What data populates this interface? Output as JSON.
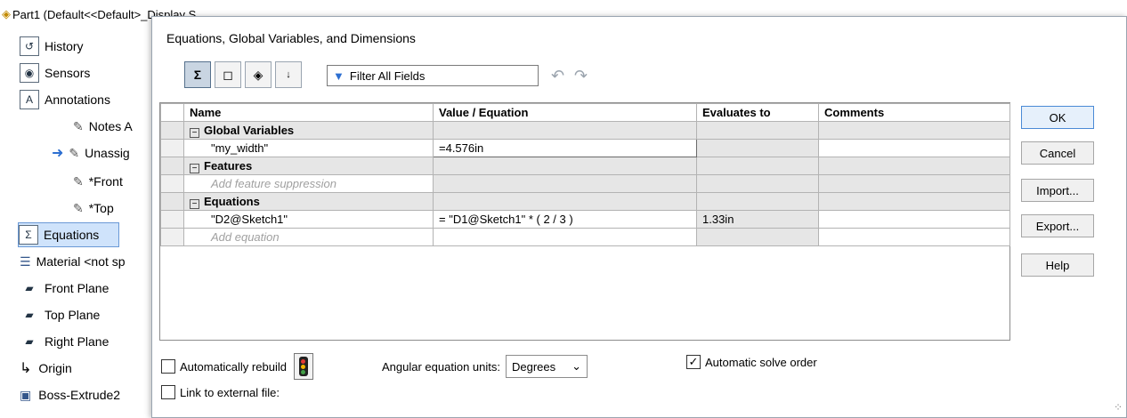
{
  "tree": {
    "part": "Part1  (Default<<Default>_Display S",
    "items": [
      {
        "label": "History",
        "icon": "history-icon"
      },
      {
        "label": "Sensors",
        "icon": "sensors-icon"
      },
      {
        "label": "Annotations",
        "icon": "annotations-icon"
      },
      {
        "label": "Notes A",
        "icon": "notes-icon"
      },
      {
        "label": "Unassig",
        "icon": "unassigned-notes-icon"
      },
      {
        "label": "*Front",
        "icon": "front-notes-icon"
      },
      {
        "label": "*Top",
        "icon": "top-notes-icon"
      },
      {
        "label": "Equations",
        "icon": "equations-icon"
      },
      {
        "label": "Material <not sp",
        "icon": "material-icon"
      },
      {
        "label": "Front Plane",
        "icon": "plane-icon"
      },
      {
        "label": "Top Plane",
        "icon": "plane-icon"
      },
      {
        "label": "Right Plane",
        "icon": "plane-icon"
      },
      {
        "label": "Origin",
        "icon": "origin-icon"
      },
      {
        "label": "Boss-Extrude2",
        "icon": "extrude-icon"
      }
    ]
  },
  "dialog": {
    "title": "Equations, Global Variables, and Dimensions",
    "filter_placeholder": "Filter All Fields",
    "columns": [
      "Name",
      "Value / Equation",
      "Evaluates to",
      "Comments"
    ],
    "groups": {
      "global_variables": "Global Variables",
      "features": "Features",
      "equations": "Equations"
    },
    "rows": {
      "gv_name": "\"my_width\"",
      "gv_value": "=4.576in",
      "features_placeholder": "Add feature suppression",
      "eq_name": "\"D2@Sketch1\"",
      "eq_value": "= \"D1@Sketch1\" * ( 2 / 3 )",
      "eq_evaluates": "1.33in",
      "eq_placeholder": "Add equation"
    },
    "buttons": {
      "ok": "OK",
      "cancel": "Cancel",
      "import": "Import...",
      "export": "Export...",
      "help": "Help"
    },
    "bottom": {
      "auto_rebuild": "Automatically rebuild",
      "angular_label": "Angular equation units:",
      "angular_value": "Degrees",
      "auto_solve": "Automatic solve order",
      "link_external": "Link to external file:"
    }
  }
}
